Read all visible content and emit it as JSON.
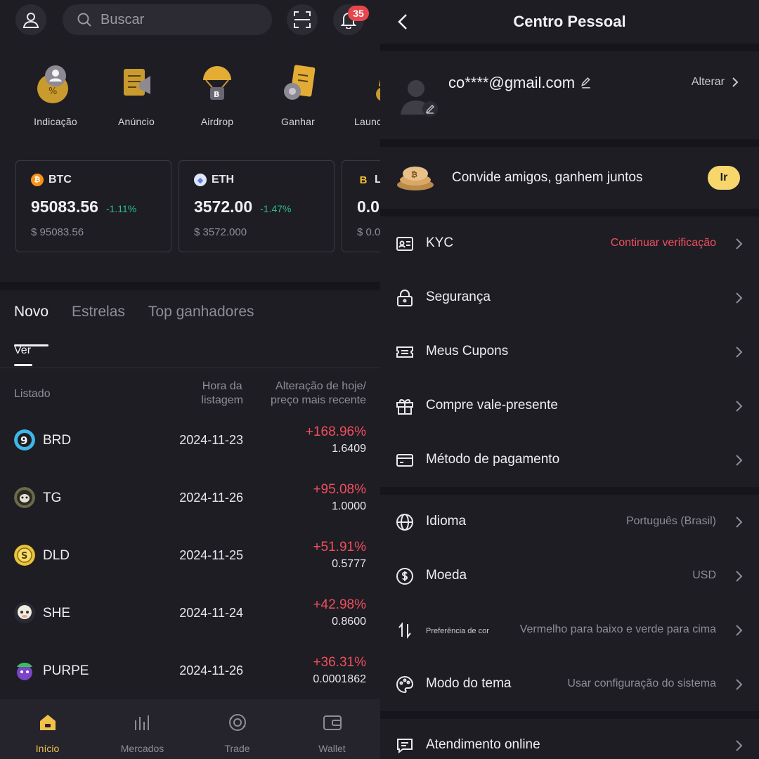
{
  "left": {
    "search_placeholder": "Buscar",
    "notification_count": "35",
    "shortcuts": [
      {
        "label": "Indicação",
        "icon": "referral-icon"
      },
      {
        "label": "Anúncio",
        "icon": "megaphone-icon"
      },
      {
        "label": "Airdrop",
        "icon": "airdrop-icon"
      },
      {
        "label": "Ganhar",
        "icon": "earn-icon"
      },
      {
        "label": "Launc",
        "icon": "launchpad-icon"
      }
    ],
    "tickers": [
      {
        "symbol": "BTC",
        "price": "95083.56",
        "change": "-1.11%",
        "usd": "$ 95083.56",
        "color": "#f7931a"
      },
      {
        "symbol": "ETH",
        "price": "3572.00",
        "change": "-1.47%",
        "usd": "$ 3572.000",
        "color": "#627eea"
      },
      {
        "symbol": "L",
        "price": "0.0",
        "change": "",
        "usd": "$ 0.0",
        "color": "#f3ba2f"
      }
    ],
    "tabs": [
      "Novo",
      "Estrelas",
      "Top ganhadores"
    ],
    "subtab": "Ver",
    "table_headers": {
      "listed": "Listado",
      "listing_time_1": "Hora da",
      "listing_time_2": "listagem",
      "change_1": "Alteração de hoje/",
      "change_2": "preço mais recente"
    },
    "rows": [
      {
        "name": "BRD",
        "date": "2024-11-23",
        "change": "+168.96%",
        "price": "1.6409"
      },
      {
        "name": "TG",
        "date": "2024-11-26",
        "change": "+95.08%",
        "price": "1.0000"
      },
      {
        "name": "DLD",
        "date": "2024-11-25",
        "change": "+51.91%",
        "price": "0.5777"
      },
      {
        "name": "SHE",
        "date": "2024-11-24",
        "change": "+42.98%",
        "price": "0.8600"
      },
      {
        "name": "PURPE",
        "date": "2024-11-26",
        "change": "+36.31%",
        "price": "0.0001862"
      }
    ],
    "nav": [
      {
        "label": "Início",
        "icon": "home-icon",
        "active": true
      },
      {
        "label": "Mercados",
        "icon": "markets-icon",
        "active": false
      },
      {
        "label": "Trade",
        "icon": "trade-icon",
        "active": false
      },
      {
        "label": "Wallet",
        "icon": "wallet-icon",
        "active": false
      }
    ]
  },
  "right": {
    "title": "Centro Pessoal",
    "email": "co****@gmail.com",
    "change_label": "Alterar",
    "invite_text": "Convide amigos, ganhem juntos",
    "invite_button": "Ir",
    "menu": [
      {
        "label": "KYC",
        "value": "Continuar verificação",
        "icon": "id-card-icon"
      },
      {
        "label": "Segurança",
        "value": "",
        "icon": "lock-icon"
      },
      {
        "label": "Meus Cupons",
        "value": "",
        "icon": "ticket-icon"
      },
      {
        "label": "Compre vale-presente",
        "value": "",
        "icon": "gift-icon"
      },
      {
        "label": "Método de pagamento",
        "value": "",
        "icon": "card-icon"
      },
      {
        "label": "Idioma",
        "value": "Português (Brasil)",
        "icon": "globe-icon"
      },
      {
        "label": "Moeda",
        "value": "USD",
        "icon": "dollar-icon"
      },
      {
        "label": "Preferência de cor",
        "value": "Vermelho para baixo e verde para cima",
        "icon": "updown-arrows-icon"
      },
      {
        "label": "Modo do tema",
        "value": "Usar configuração do sistema",
        "icon": "palette-icon"
      },
      {
        "label": "Atendimento online",
        "value": "",
        "icon": "chat-icon"
      }
    ]
  },
  "colors": {
    "background": "#1e1d24",
    "accent_yellow": "#f1c14a",
    "down_green": "#2cbd87",
    "up_red": "#f04f5c"
  }
}
